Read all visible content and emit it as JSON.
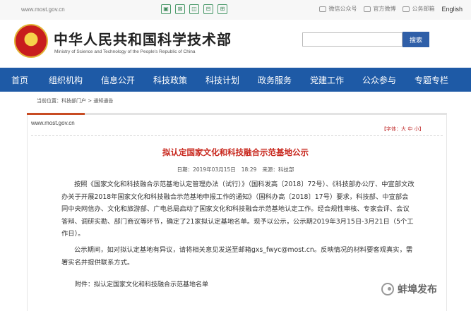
{
  "topbar": {
    "url": "www.most.gov.cn",
    "tools": [
      "▣",
      "⊠",
      "◫",
      "⊟",
      "⊞"
    ],
    "wechat": "微信公众号",
    "weibo": "官方微博",
    "email": "公务邮箱",
    "english": "English"
  },
  "header": {
    "title_cn": "中华人民共和国科学技术部",
    "title_en": "Ministry of Science and Technology of the People's Republic of China",
    "search_placeholder": "",
    "search_button": "搜索"
  },
  "nav": {
    "items": [
      "首页",
      "组织机构",
      "信息公开",
      "科技政策",
      "科技计划",
      "政务服务",
      "党建工作",
      "公众参与",
      "专题专栏"
    ]
  },
  "breadcrumb": "当前位置：科技部门户 > 通知通告",
  "article": {
    "site_url": "www.most.gov.cn",
    "font_label": "【字体：",
    "font_large": "大",
    "font_medium": "中",
    "font_small": "小",
    "font_close": "】",
    "title": "拟认定国家文化和科技融合示范基地公示",
    "date": "日期：2019年03月15日",
    "time": "18:29",
    "source": "来源：科技部",
    "p1": "按照《国家文化和科技融合示范基地认定管理办法（试行）》（国科发高〔2018〕72号）、《科技部办公厅、中宣部文改办关于开展2018年国家文化和科技融合示范基地申报工作的通知》（国科办高〔2018〕17号）要求，科技部、中宣部会同中央网信办、文化和旅游部、广电总局启动了国家文化和科技融合示范基地认定工作。经合规性审核、专家会评、会议答辩、调研实勘、部门商议等环节，确定了21家拟认定基地名单。现予以公示，公示期2019年3月15日-3月21日（5个工作日）。",
    "p2": "公示期间，如对拟认定基地有异议，请将相关意见发送至邮箱gxs_fwyc@most.cn。反映情况的材料要客观真实，需署实名并提供联系方式。",
    "attachment": "附件：拟认定国家文化和科技融合示范基地名单"
  },
  "watermark": "蚌埠发布"
}
